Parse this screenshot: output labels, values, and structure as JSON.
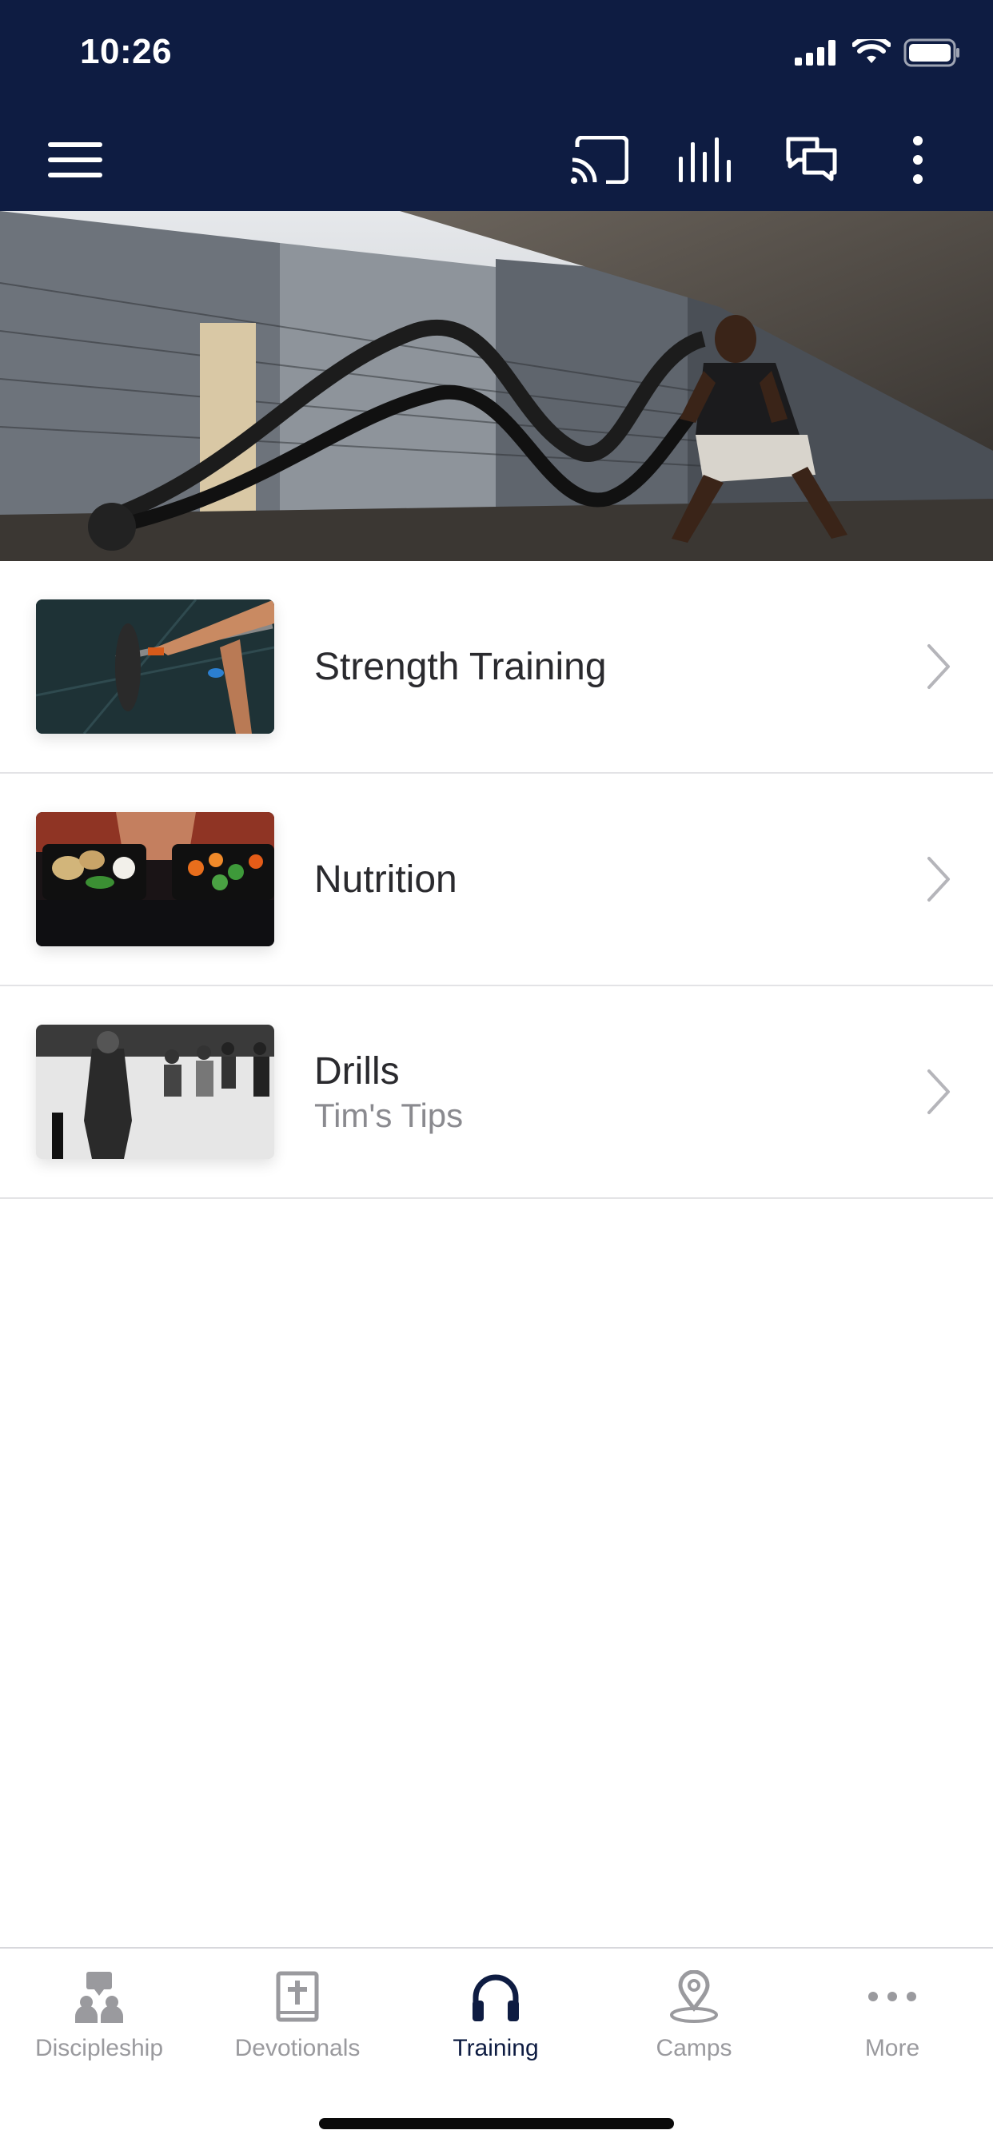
{
  "status_bar": {
    "time": "10:26"
  },
  "toolbar": {
    "menu_icon": "hamburger-menu-icon",
    "cast_icon": "cast-icon",
    "audio_icon": "equalizer-bars-icon",
    "chat_icon": "chat-bubbles-icon",
    "more_icon": "vertical-ellipsis-icon"
  },
  "colors": {
    "header_bg": "#0e1c42",
    "accent": "#0e1c42",
    "inactive": "#9a9a9e",
    "title_text": "#2a2a2e",
    "subtitle_text": "#8a8a8f"
  },
  "hero": {
    "image": "battle-ropes-athlete-photo"
  },
  "list": {
    "items": [
      {
        "title": "Strength Training",
        "subtitle": "",
        "thumbnail": "barbell-gym-photo"
      },
      {
        "title": "Nutrition",
        "subtitle": "",
        "thumbnail": "meal-prep-containers-photo"
      },
      {
        "title": "Drills",
        "subtitle": "Tim's Tips",
        "thumbnail": "hockey-practice-photo"
      }
    ]
  },
  "tabbar": {
    "tabs": [
      {
        "label": "Discipleship",
        "icon": "people-chat-icon",
        "active": false
      },
      {
        "label": "Devotionals",
        "icon": "bible-icon",
        "active": false
      },
      {
        "label": "Training",
        "icon": "headphones-icon",
        "active": true
      },
      {
        "label": "Camps",
        "icon": "map-pin-icon",
        "active": false
      },
      {
        "label": "More",
        "icon": "horizontal-ellipsis-icon",
        "active": false
      }
    ]
  }
}
